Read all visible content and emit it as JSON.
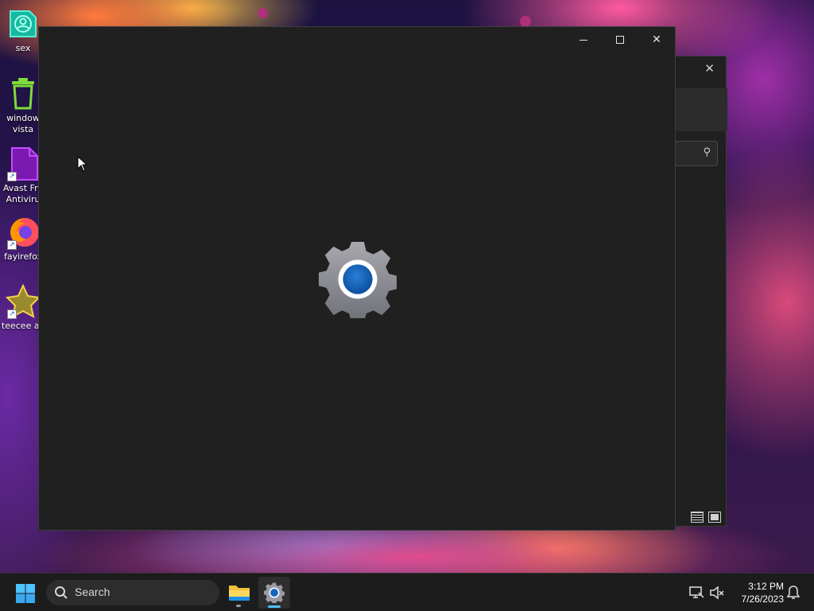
{
  "desktop": {
    "icons": [
      {
        "label": "sex"
      },
      {
        "label": "window vista"
      },
      {
        "label": "Avast Fre Antiviru"
      },
      {
        "label": "fayirefox"
      },
      {
        "label": "teecee ax"
      }
    ]
  },
  "main_window": {
    "app": "Settings",
    "splash_icon": "settings-gear-icon",
    "caption_buttons": [
      "minimize-icon",
      "maximize-icon",
      "close-icon"
    ]
  },
  "background_window": {
    "search_icon": "search-icon",
    "view_buttons": [
      "details-view-icon",
      "preview-view-icon"
    ]
  },
  "taskbar": {
    "search_label": "Search",
    "apps": [
      "File Explorer",
      "Settings"
    ],
    "clock_time": "3:12 PM",
    "clock_date": "7/26/2023"
  },
  "colors": {
    "window_bg": "#202020",
    "taskbar_bg": "#1c1c1c",
    "accent": "#4cc2ff"
  }
}
